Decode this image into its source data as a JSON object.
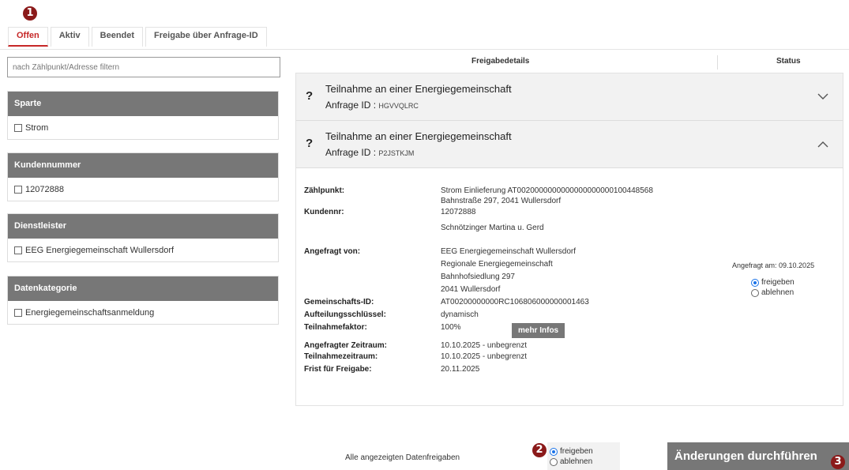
{
  "markers": [
    "1",
    "2",
    "3"
  ],
  "tabs": [
    {
      "label": "Offen",
      "active": true
    },
    {
      "label": "Aktiv",
      "active": false
    },
    {
      "label": "Beendet",
      "active": false
    },
    {
      "label": "Freigabe über Anfrage-ID",
      "active": false
    }
  ],
  "filter": {
    "placeholder": "nach Zählpunkt/Adresse filtern"
  },
  "filter_groups": [
    {
      "title": "Sparte",
      "item": "Strom"
    },
    {
      "title": "Kundennummer",
      "item": "12072888"
    },
    {
      "title": "Dienstleister",
      "item": "EEG Energiegemeinschaft Wullersdorf"
    },
    {
      "title": "Datenkategorie",
      "item": "Energiegemeinschaftsanmeldung"
    }
  ],
  "columns": {
    "details": "Freigabedetails",
    "status": "Status"
  },
  "requests": [
    {
      "icon": "?",
      "title": "Teilnahme an einer Energiegemeinschaft",
      "id_label": "Anfrage ID :",
      "id_value": "HGVVQLRC",
      "expanded": false
    },
    {
      "icon": "?",
      "title": "Teilnahme an einer Energiegemeinschaft",
      "id_label": "Anfrage ID :",
      "id_value": "P2JSTKJM",
      "expanded": true
    }
  ],
  "details": {
    "zaehlpunkt_label": "Zählpunkt:",
    "zaehlpunkt_line1": "Strom Einlieferung AT0020000000000000000000100448568",
    "zaehlpunkt_line2": "Bahnstraße 297, 2041 Wullersdorf",
    "kundennr_label": "Kundennr:",
    "kundennr_line1": "12072888",
    "kundennr_line2": "Schnötzinger Martina u. Gerd",
    "angefragt_label": "Angefragt von:",
    "angefragt_line1": "EEG Energiegemeinschaft Wullersdorf",
    "angefragt_line2": "Regionale Energiegemeinschaft",
    "angefragt_line3": "Bahnhofsiedlung 297",
    "angefragt_line4": "2041 Wullersdorf",
    "gem_id_label": "Gemeinschafts-ID:",
    "gem_id_value": "AT00200000000RC106806000000001463",
    "aufteilung_label": "Aufteilungsschlüssel:",
    "aufteilung_value": "dynamisch",
    "faktor_label": "Teilnahmefaktor:",
    "faktor_value": "100%",
    "mehr_infos": "mehr Infos",
    "zeitraum_label": "Angefragter Zeitraum:",
    "zeitraum_value": "10.10.2025 - unbegrenzt",
    "teilnahmezeitraum_label": "Teilnahmezeitraum:",
    "teilnahmezeitraum_value": "10.10.2025 - unbegrenzt",
    "frist_label": "Frist für Freigabe:",
    "frist_value": "20.11.2025",
    "angefragt_am": "Angefragt am: 09.10.2025",
    "radio_yes": "freigeben",
    "radio_no": "ablehnen",
    "selected": "freigeben"
  },
  "bottom": {
    "all_label": "Alle angezeigten Datenfreigaben",
    "radio_yes": "freigeben",
    "radio_no": "ablehnen",
    "selected": "freigeben",
    "apply_label": "Änderungen durchführen"
  },
  "colors": {
    "accent": "#c62828",
    "marker": "#8b1a1a",
    "header_gray": "#777777",
    "radio_blue": "#1a73e8"
  }
}
